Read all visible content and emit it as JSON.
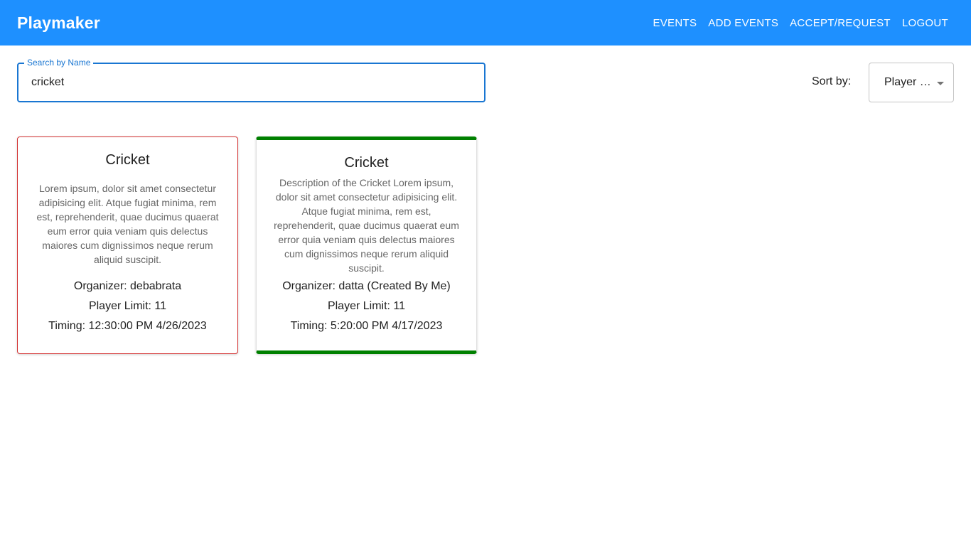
{
  "app": {
    "title": "Playmaker"
  },
  "nav": {
    "items": [
      "EVENTS",
      "ADD EVENTS",
      "ACCEPT/REQUEST",
      "LOGOUT"
    ]
  },
  "search": {
    "label": "Search by Name",
    "value": "cricket"
  },
  "sort": {
    "label": "Sort by:",
    "value": "Player Limit"
  },
  "colors": {
    "appbar": "#1e90ff",
    "card_other_border": "#d32f2f",
    "card_mine_border": "#008000",
    "focus": "#1976d2"
  },
  "events": [
    {
      "name": "Cricket",
      "description": "Lorem ipsum, dolor sit amet consectetur adipisicing elit. Atque fugiat minima, rem est, reprehenderit, quae ducimus quaerat eum error quia veniam quis delectus maiores cum dignissimos neque rerum aliquid suscipit.",
      "organizer": "Organizer: debabrata",
      "player_limit": "Player Limit: 11",
      "timing": "Timing: 12:30:00 PM 4/26/2023"
    },
    {
      "name": "Cricket",
      "description": "Description of the Cricket Lorem ipsum, dolor sit amet consectetur adipisicing elit. Atque fugiat minima, rem est, reprehenderit, quae ducimus quaerat eum error quia veniam quis delectus maiores cum dignissimos neque rerum aliquid suscipit.",
      "organizer": "Organizer: datta (Created By Me)",
      "player_limit": "Player Limit: 11",
      "timing": "Timing: 5:20:00 PM 4/17/2023"
    }
  ]
}
